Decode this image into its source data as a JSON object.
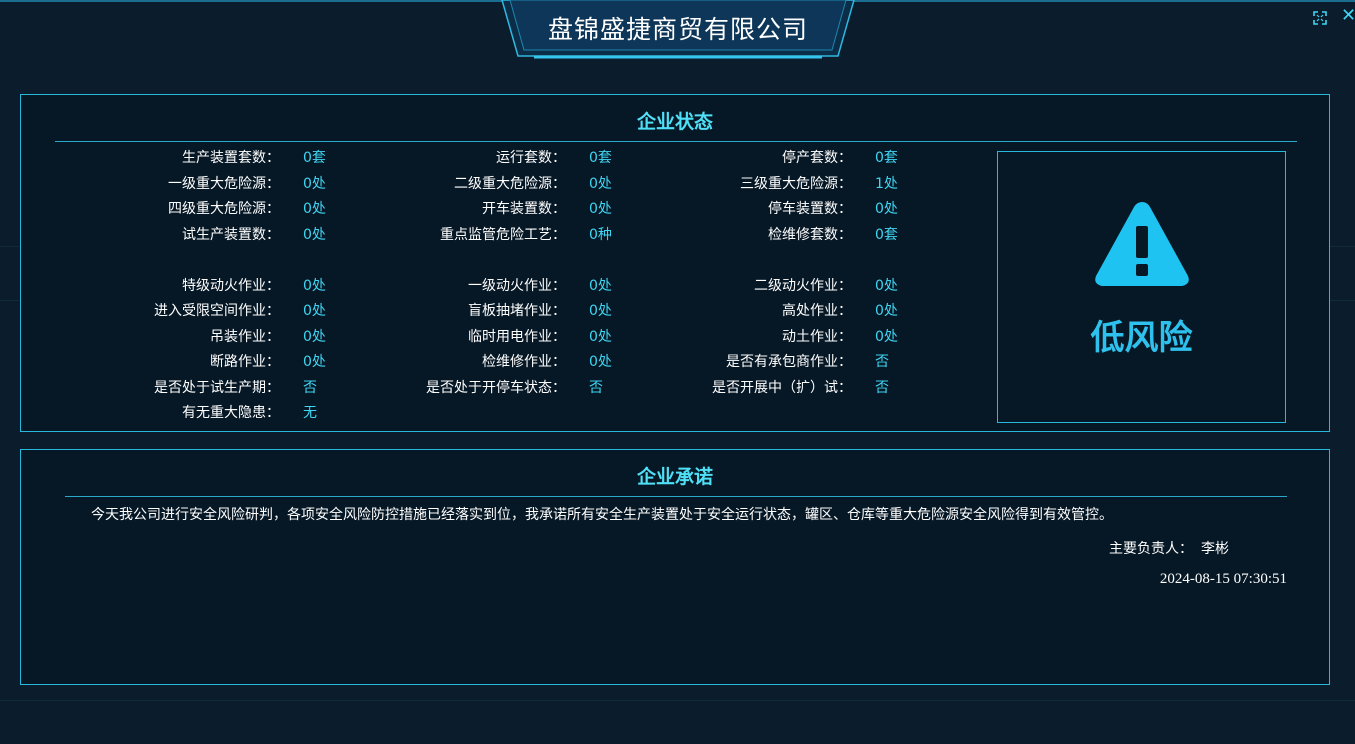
{
  "company_name": "盘锦盛捷商贸有限公司",
  "status_panel": {
    "title": "企业状态",
    "rows": [
      [
        {
          "label": "生产装置套数：",
          "value": "0套"
        },
        {
          "label": "运行套数：",
          "value": "0套"
        },
        {
          "label": "停产套数：",
          "value": "0套"
        }
      ],
      [
        {
          "label": "一级重大危险源：",
          "value": "0处"
        },
        {
          "label": "二级重大危险源：",
          "value": "0处"
        },
        {
          "label": "三级重大危险源：",
          "value": "1处"
        }
      ],
      [
        {
          "label": "四级重大危险源：",
          "value": "0处"
        },
        {
          "label": "开车装置数：",
          "value": "0处"
        },
        {
          "label": "停车装置数：",
          "value": "0处"
        }
      ],
      [
        {
          "label": "试生产装置数：",
          "value": "0处"
        },
        {
          "label": "重点监管危险工艺：",
          "value": "0种"
        },
        {
          "label": "检维修套数：",
          "value": "0套"
        }
      ],
      [
        {
          "label": "特级动火作业：",
          "value": "0处"
        },
        {
          "label": "一级动火作业：",
          "value": "0处"
        },
        {
          "label": "二级动火作业：",
          "value": "0处"
        }
      ],
      [
        {
          "label": "进入受限空间作业：",
          "value": "0处"
        },
        {
          "label": "盲板抽堵作业：",
          "value": "0处"
        },
        {
          "label": "高处作业：",
          "value": "0处"
        }
      ],
      [
        {
          "label": "吊装作业：",
          "value": "0处"
        },
        {
          "label": "临时用电作业：",
          "value": "0处"
        },
        {
          "label": "动土作业：",
          "value": "0处"
        }
      ],
      [
        {
          "label": "断路作业：",
          "value": "0处"
        },
        {
          "label": "检维修作业：",
          "value": "0处"
        },
        {
          "label": "是否有承包商作业：",
          "value": "否"
        }
      ],
      [
        {
          "label": "是否处于试生产期：",
          "value": "否"
        },
        {
          "label": "是否处于开停车状态：",
          "value": "否"
        },
        {
          "label": "是否开展中（扩）试：",
          "value": "否"
        }
      ],
      [
        {
          "label": "有无重大隐患：",
          "value": "无"
        }
      ]
    ],
    "risk_level": "低风险",
    "risk_icon": "warning-triangle-icon",
    "accent_color": "#3fd6f3",
    "risk_color": "#2ec1ee"
  },
  "promise_panel": {
    "title": "企业承诺",
    "text": "今天我公司进行安全风险研判，各项安全风险防控措施已经落实到位，我承诺所有安全生产装置处于安全运行状态，罐区、仓库等重大危险源安全风险得到有效管控。",
    "responsible_label": "主要负责人：",
    "responsible_name": "李彬",
    "timestamp": "2024-08-15 07:30:51"
  }
}
